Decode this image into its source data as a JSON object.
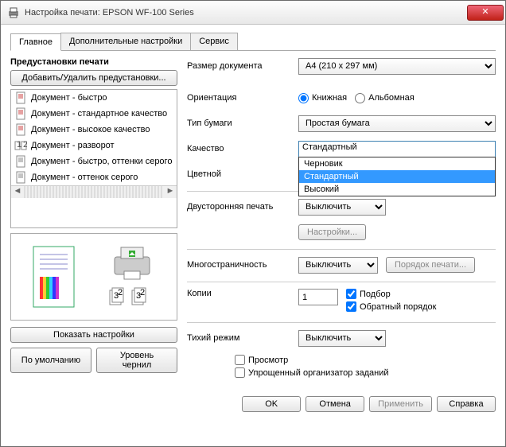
{
  "window": {
    "title": "Настройка печати: EPSON WF-100 Series"
  },
  "tabs": [
    "Главное",
    "Дополнительные настройки",
    "Сервис"
  ],
  "presets": {
    "title": "Предустановки печати",
    "add_remove": "Добавить/Удалить предустановки...",
    "items": [
      "Документ - быстро",
      "Документ - стандартное качество",
      "Документ - высокое качество",
      "Документ - разворот",
      "Документ - быстро, оттенки серого",
      "Документ - оттенок серого"
    ]
  },
  "buttons": {
    "show_settings": "Показать настройки",
    "defaults": "По умолчанию",
    "ink_levels": "Уровень чернил",
    "settings": "Настройки...",
    "page_order": "Порядок печати..."
  },
  "labels": {
    "doc_size": "Размер документа",
    "orientation": "Ориентация",
    "portrait": "Книжная",
    "landscape": "Альбомная",
    "paper_type": "Тип бумаги",
    "quality": "Качество",
    "color": "Цветной",
    "duplex": "Двусторонняя печать",
    "multipage": "Многостраничность",
    "copies": "Копии",
    "collate": "Подбор",
    "reverse": "Обратный порядок",
    "quiet": "Тихий режим",
    "preview": "Просмотр",
    "simple_org": "Упрощенный организатор заданий"
  },
  "values": {
    "doc_size": "A4 (210 x 297 мм)",
    "paper_type": "Простая бумага",
    "quality": "Стандартный",
    "duplex": "Выключить",
    "multipage": "Выключить",
    "copies": "1",
    "quiet": "Выключить"
  },
  "quality_options": [
    "Черновик",
    "Стандартный",
    "Высокий"
  ],
  "footer": {
    "ok": "OK",
    "cancel": "Отмена",
    "apply": "Применить",
    "help": "Справка"
  }
}
